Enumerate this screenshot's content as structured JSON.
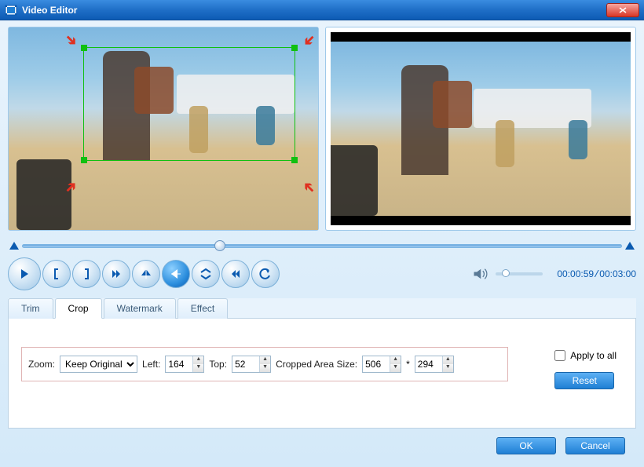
{
  "window": {
    "title": "Video Editor"
  },
  "timeline": {
    "current": "00:00:59",
    "total": "00:03:00"
  },
  "tabs": {
    "trim": "Trim",
    "crop": "Crop",
    "watermark": "Watermark",
    "effect": "Effect",
    "active": "crop"
  },
  "crop": {
    "zoom_label": "Zoom:",
    "zoom_value": "Keep Original",
    "left_label": "Left:",
    "left_value": "164",
    "top_label": "Top:",
    "top_value": "52",
    "area_label": "Cropped Area Size:",
    "width_value": "506",
    "sep": "*",
    "height_value": "294"
  },
  "actions": {
    "apply_all": "Apply to all",
    "reset": "Reset",
    "ok": "OK",
    "cancel": "Cancel"
  }
}
